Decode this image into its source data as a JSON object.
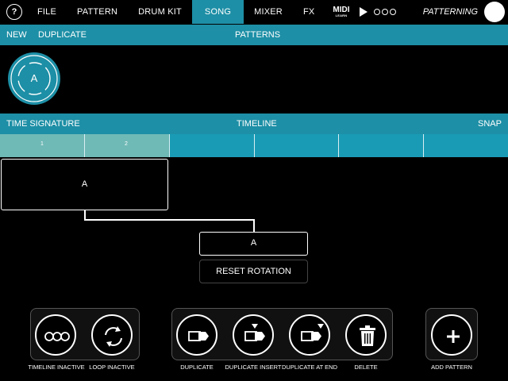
{
  "menu": {
    "help_label": "?",
    "items": [
      {
        "label": "FILE",
        "active": false
      },
      {
        "label": "PATTERN",
        "active": false
      },
      {
        "label": "DRUM KIT",
        "active": false
      },
      {
        "label": "SONG",
        "active": true
      },
      {
        "label": "MIXER",
        "active": false
      },
      {
        "label": "FX",
        "active": false
      }
    ],
    "midi_label": "MIDI",
    "midi_sub": "LEARN",
    "mode_label": "PATTERNING"
  },
  "patterns_bar": {
    "new_label": "NEW",
    "duplicate_label": "DUPLICATE",
    "title": "PATTERNS"
  },
  "patterns": [
    {
      "label": "A"
    }
  ],
  "timeline_bar": {
    "time_signature_label": "TIME SIGNATURE",
    "title": "TIMELINE",
    "snap_label": "SNAP"
  },
  "ruler": {
    "numbers": [
      "1",
      "2"
    ]
  },
  "timeline_block": {
    "label": "A"
  },
  "selected_block": {
    "label": "A"
  },
  "reset_rotation_label": "RESET ROTATION",
  "controls": {
    "timeline_inactive": "TIMELINE INACTIVE",
    "loop_inactive": "LOOP INACTIVE",
    "duplicate": "DUPLICATE",
    "duplicate_insert": "DUPLICATE INSERT",
    "duplicate_at_end": "DUPLICATE AT END",
    "delete": "DELETE",
    "add_pattern": "ADD PATTERN"
  },
  "colors": {
    "accent": "#1d8fa6",
    "ruler_active": "#6fb9b6",
    "background": "#000000"
  }
}
